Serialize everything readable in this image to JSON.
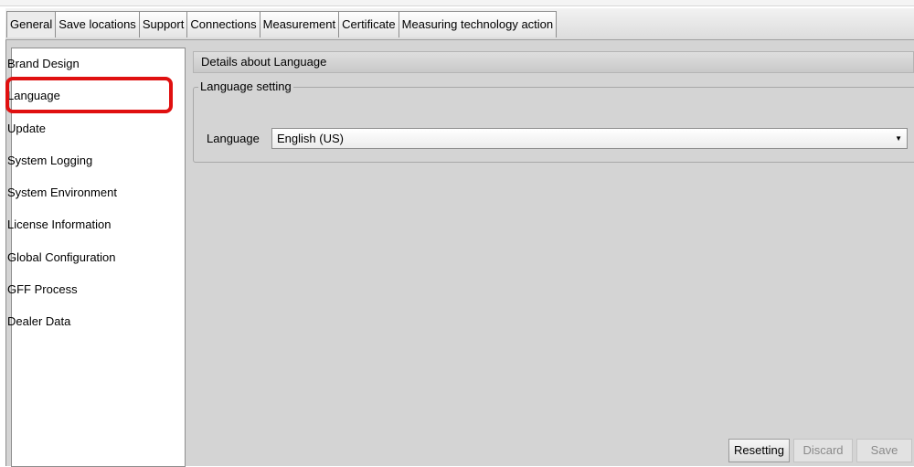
{
  "tabs": [
    {
      "label": "General"
    },
    {
      "label": "Save locations"
    },
    {
      "label": "Support"
    },
    {
      "label": "Connections"
    },
    {
      "label": "Measurement"
    },
    {
      "label": "Certificate"
    },
    {
      "label": "Measuring technology action"
    }
  ],
  "active_tab": "General",
  "sidebar": {
    "items": [
      {
        "label": "Brand Design"
      },
      {
        "label": "Language"
      },
      {
        "label": "Update"
      },
      {
        "label": "System Logging"
      },
      {
        "label": "System Environment"
      },
      {
        "label": "License Information"
      },
      {
        "label": "Global Configuration"
      },
      {
        "label": "GFF Process"
      },
      {
        "label": "Dealer Data"
      }
    ],
    "selected": "Language"
  },
  "details": {
    "title": "Details about Language"
  },
  "group": {
    "title": "Language setting",
    "field_label": "Language",
    "selected_value": "English (US)"
  },
  "buttons": {
    "reset": "Resetting",
    "discard": "Discard",
    "save": "Save"
  },
  "colors": {
    "highlight": "#e01010",
    "panel": "#d4d4d4"
  }
}
